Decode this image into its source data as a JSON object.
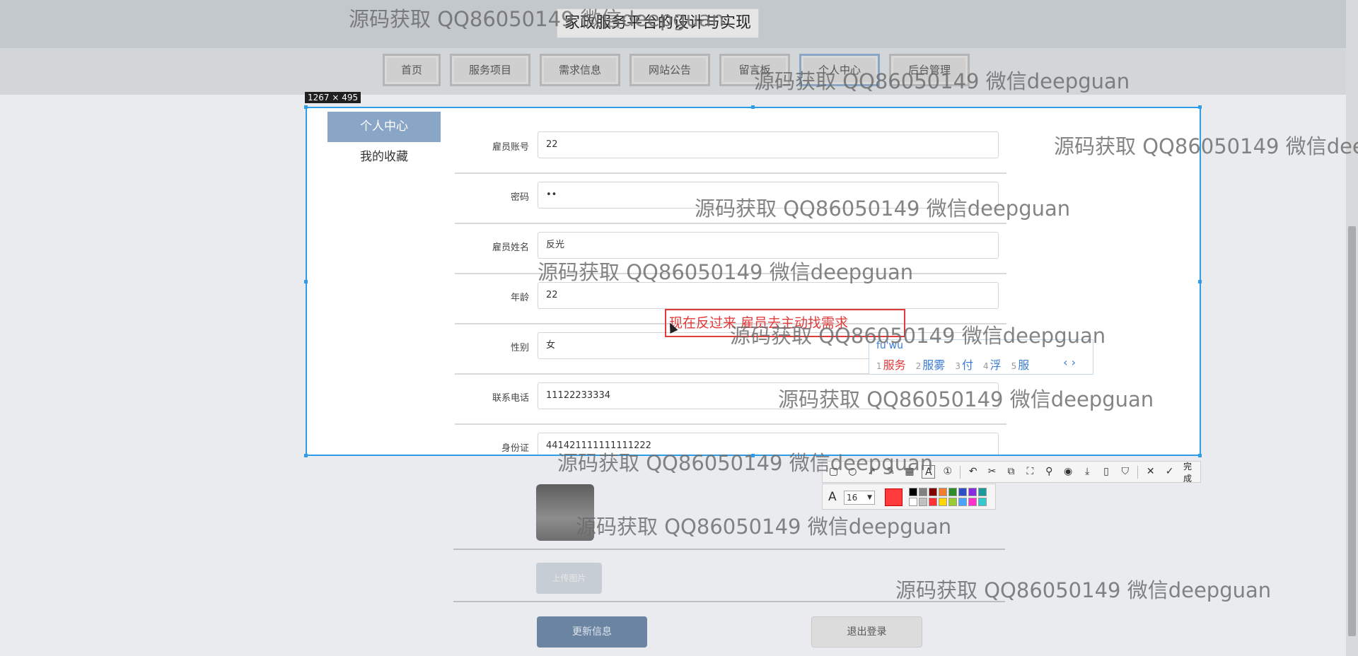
{
  "site": {
    "title": "家政服务平台的设计与实现"
  },
  "nav": {
    "items": [
      "首页",
      "服务项目",
      "需求信息",
      "网站公告",
      "留言板",
      "个人中心",
      "后台管理"
    ],
    "active": "个人中心"
  },
  "capture": {
    "size_label": "1267 × 495"
  },
  "side_menu": {
    "active_label": "个人中心",
    "favorites_label": "我的收藏"
  },
  "form": {
    "fields": [
      {
        "label": "雇员账号",
        "value": "22"
      },
      {
        "label": "密码",
        "value": "••"
      },
      {
        "label": "雇员姓名",
        "value": "反光"
      },
      {
        "label": "年龄",
        "value": "22"
      },
      {
        "label": "性别",
        "value": "女"
      },
      {
        "label": "联系电话",
        "value": "11122233334"
      },
      {
        "label": "身份证",
        "value": "441421111111111222"
      }
    ],
    "upload_label": "上传图片",
    "update_label": "更新信息",
    "logout_label": "退出登录"
  },
  "annotation": {
    "text": "现在反过来 雇员去主动找需求"
  },
  "ime": {
    "pinyin": "fu'wu",
    "candidates": [
      {
        "num": "1",
        "text": "服务"
      },
      {
        "num": "2",
        "text": "服雾"
      },
      {
        "num": "3",
        "text": "付"
      },
      {
        "num": "4",
        "text": "浮"
      },
      {
        "num": "5",
        "text": "服"
      }
    ],
    "arrows": "‹ ›"
  },
  "toolbar": {
    "icons": [
      "rect-icon",
      "ellipse-icon",
      "arrow-icon",
      "pen-icon",
      "mosaic-icon",
      "text-icon",
      "number-icon",
      "undo-icon",
      "translate-icon",
      "ocr-icon",
      "long-shot-icon",
      "pin-icon",
      "record-icon",
      "download-icon",
      "phone-icon",
      "bookmark-icon",
      "close-icon",
      "check-icon"
    ],
    "done_label": "完成",
    "font_size": "16",
    "current_color": "#ff3b3b",
    "palette": [
      "#000000",
      "#808080",
      "#800000",
      "#f08030",
      "#2e8b2e",
      "#2f4fc8",
      "#8a2be2",
      "#1a9a9a",
      "#ffffff",
      "#c0c0c0",
      "#ff3333",
      "#ffd700",
      "#99cc33",
      "#4aa3ff",
      "#ff33cc",
      "#33cccc"
    ]
  },
  "watermark": {
    "text": "源码获取 QQ86050149 微信deepguan"
  }
}
